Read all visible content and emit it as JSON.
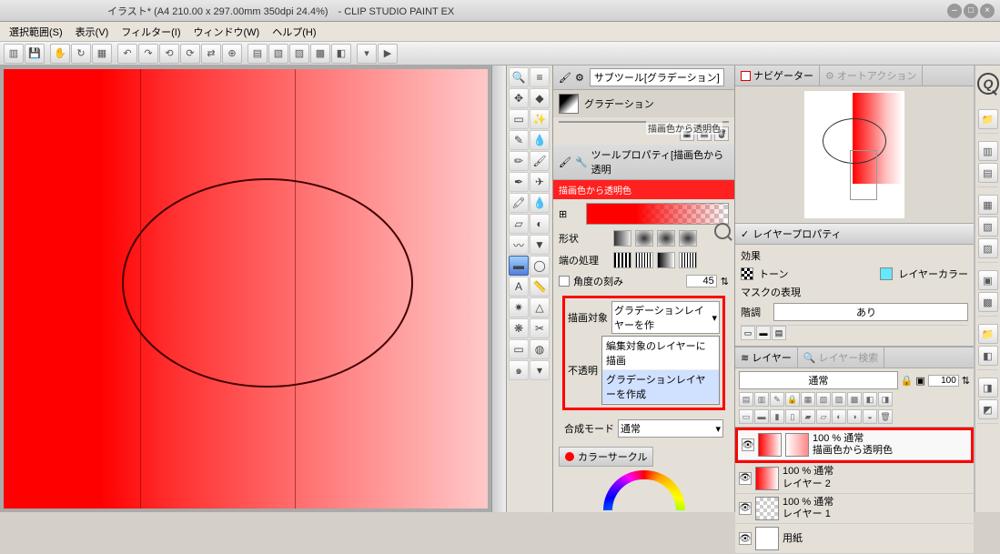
{
  "titlebar": {
    "text": "イラスト* (A4 210.00 x 297.00mm 350dpi 24.4%)　- CLIP STUDIO PAINT EX"
  },
  "menu": {
    "sel": "選択範囲(S)",
    "view": "表示(V)",
    "filter": "フィルター(I)",
    "window": "ウィンドウ(W)",
    "help": "ヘルプ(H)"
  },
  "subtool": {
    "tab": "サブツール[グラデーション]",
    "label": "グラデーション",
    "swatch_name": "描画色から透明色"
  },
  "toolprop": {
    "tab": "ツールプロパティ[描画色から透明",
    "title": "描画色から透明色",
    "shape": "形状",
    "edge": "端の処理",
    "angle_step": "角度の刻み",
    "angle_val": "45",
    "draw_target": "描画対象",
    "dd_selected": "グラデーションレイヤーを作",
    "dd_opt1": "編集対象のレイヤーに描画",
    "dd_opt2": "グラデーションレイヤーを作成",
    "opacity": "不透明",
    "blend": "合成モード",
    "blend_val": "通常"
  },
  "colorcircle": {
    "tab": "カラーサークル"
  },
  "nav": {
    "tab1": "ナビゲーター",
    "tab2": "オートアクション"
  },
  "layerprop": {
    "tab": "レイヤープロパティ",
    "effect": "効果",
    "tone": "トーン",
    "layercolor": "レイヤーカラー",
    "mask": "マスクの表現",
    "grad": "階調",
    "grad_val": "あり"
  },
  "layers": {
    "tab1": "レイヤー",
    "tab2": "レイヤー検索",
    "blend": "通常",
    "opacity": "100",
    "list": [
      {
        "pct": "100 % 通常",
        "name": "描画色から透明色"
      },
      {
        "pct": "100 % 通常",
        "name": "レイヤー 2"
      },
      {
        "pct": "100 % 通常",
        "name": "レイヤー 1"
      },
      {
        "pct": "",
        "name": "用紙"
      }
    ]
  }
}
